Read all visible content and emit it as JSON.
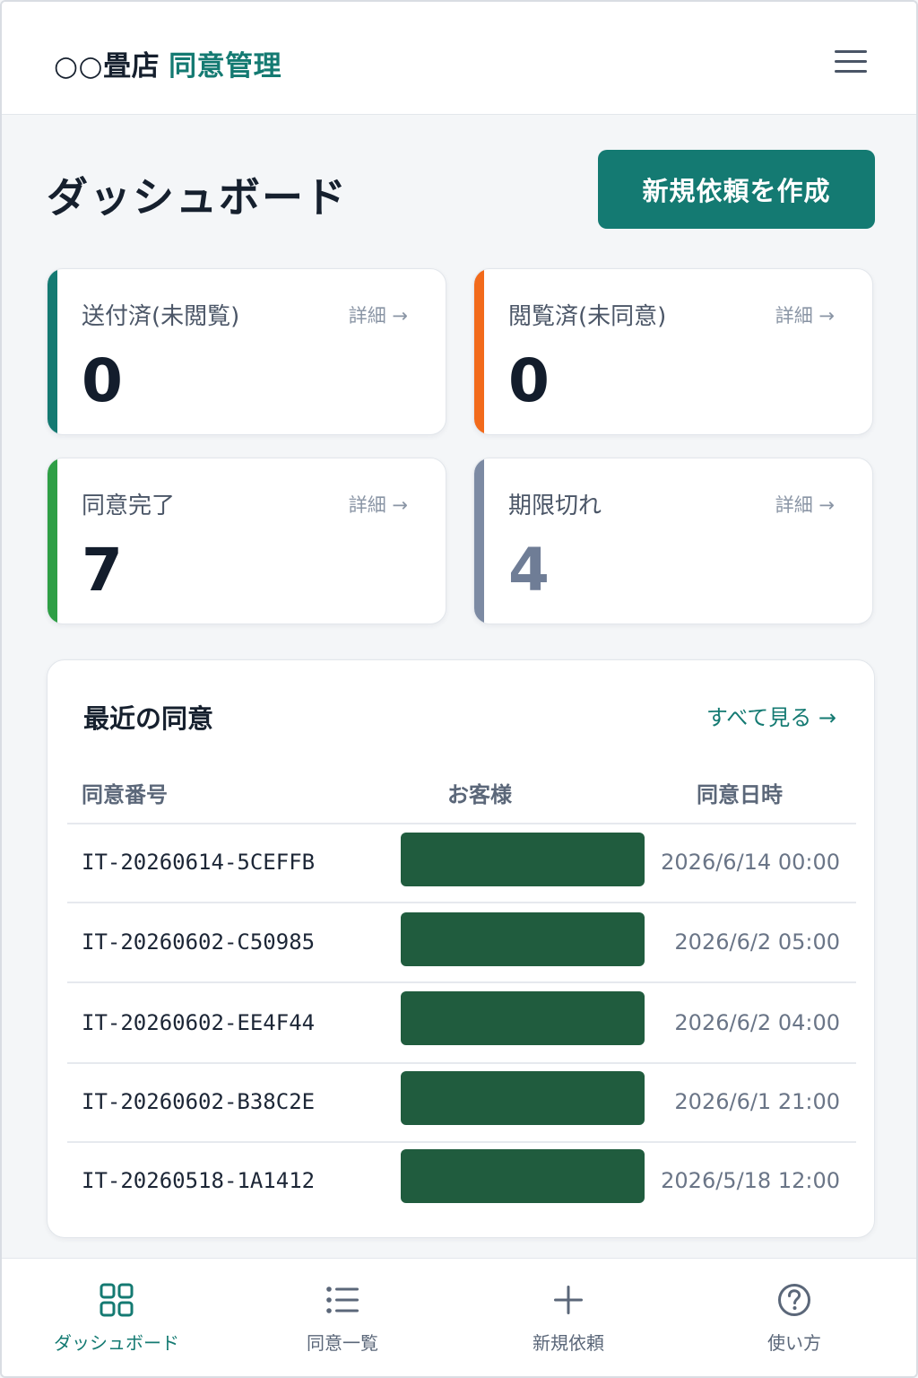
{
  "header": {
    "shop_name": "○○畳店",
    "app_name": "同意管理",
    "menu_icon": "menu-icon"
  },
  "page": {
    "title": "ダッシュボード",
    "create_button": "新規依頼を作成"
  },
  "stats": [
    {
      "label": "送付済(未閲覧)",
      "more": "詳細 →",
      "value": "0",
      "color": "#147a72"
    },
    {
      "label": "閲覧済(未同意)",
      "more": "詳細 →",
      "value": "0",
      "color": "#f26a1b"
    },
    {
      "label": "同意完了",
      "more": "詳細 →",
      "value": "7",
      "color": "#2e9f45"
    },
    {
      "label": "期限切れ",
      "more": "詳細 →",
      "value": "4",
      "color": "#7c8aa3"
    }
  ],
  "recent": {
    "title": "最近の同意",
    "see_all": "すべて見る →",
    "columns": [
      "同意番号",
      "お客様",
      "同意日時"
    ],
    "rows": [
      {
        "id": "IT-20260614-5CEFFB",
        "date": "2026/6/14 00:00"
      },
      {
        "id": "IT-20260602-C50985",
        "date": "2026/6/2 05:00"
      },
      {
        "id": "IT-20260602-EE4F44",
        "date": "2026/6/2 04:00"
      },
      {
        "id": "IT-20260602-B38C2E",
        "date": "2026/6/1 21:00"
      },
      {
        "id": "IT-20260518-1A1412",
        "date": "2026/5/18 12:00"
      }
    ],
    "redaction_color": "#205c3e"
  },
  "nav": [
    {
      "label": "ダッシュボード",
      "icon": "grid-icon",
      "active": true
    },
    {
      "label": "同意一覧",
      "icon": "list-icon",
      "active": false
    },
    {
      "label": "新規依頼",
      "icon": "plus-icon",
      "active": false
    },
    {
      "label": "使い方",
      "icon": "help-icon",
      "active": false
    }
  ],
  "colors": {
    "accent": "#147a72",
    "background": "#f4f6f8"
  }
}
